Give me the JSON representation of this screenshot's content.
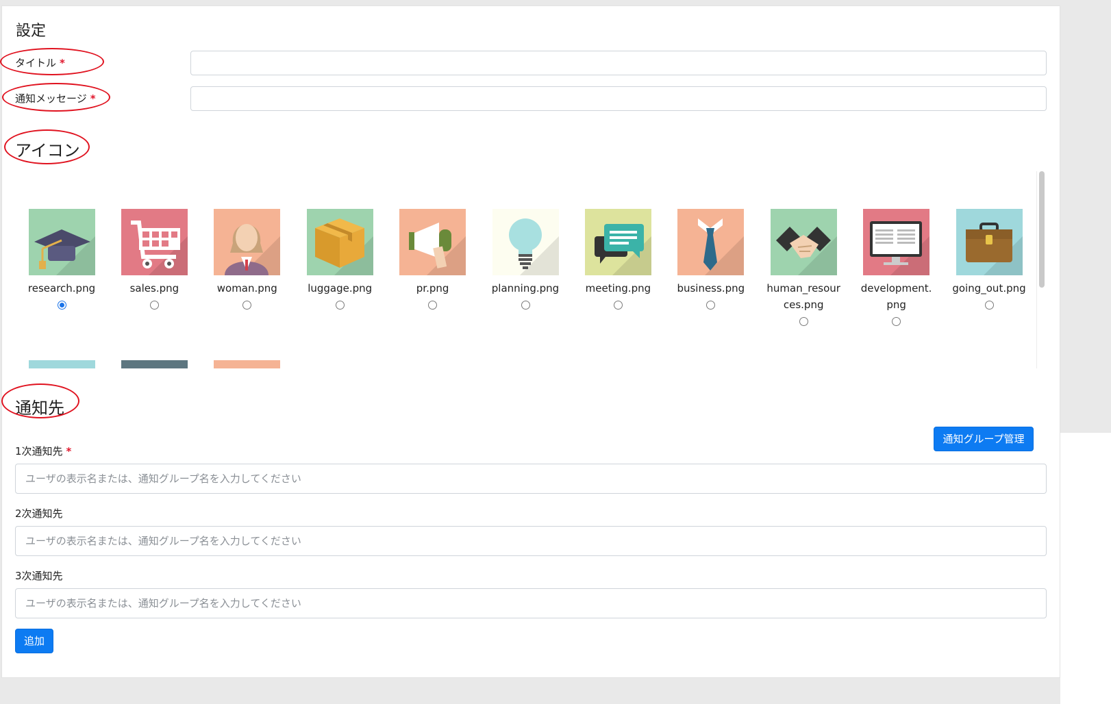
{
  "settings": {
    "title": "設定",
    "fields": [
      {
        "label": "タイトル",
        "required_mark": "*",
        "value": ""
      },
      {
        "label": "通知メッセージ",
        "required_mark": "*",
        "value": ""
      }
    ]
  },
  "icons": {
    "title": "アイコン",
    "items": [
      {
        "name": "research.png",
        "bg": "#9ed3ae",
        "symbol": "graduation-cap-icon",
        "selected": true
      },
      {
        "name": "sales.png",
        "bg": "#e27a85",
        "symbol": "shopping-cart-icon",
        "selected": false
      },
      {
        "name": "woman.png",
        "bg": "#f5b394",
        "symbol": "woman-icon",
        "selected": false
      },
      {
        "name": "luggage.png",
        "bg": "#9ed3ae",
        "symbol": "box-icon",
        "selected": false
      },
      {
        "name": "pr.png",
        "bg": "#f5b394",
        "symbol": "megaphone-icon",
        "selected": false
      },
      {
        "name": "planning.png",
        "bg": "#fdfdf0",
        "symbol": "lightbulb-icon",
        "selected": false
      },
      {
        "name": "meeting.png",
        "bg": "#dde39d",
        "symbol": "speech-bubbles-icon",
        "selected": false
      },
      {
        "name": "business.png",
        "bg": "#f5b394",
        "symbol": "necktie-icon",
        "selected": false
      },
      {
        "name": "human_resources.png",
        "bg": "#9ed3ae",
        "symbol": "handshake-icon",
        "selected": false
      },
      {
        "name": "development.png",
        "bg": "#e27a85",
        "symbol": "monitor-icon",
        "selected": false
      },
      {
        "name": "going_out.png",
        "bg": "#9fd8dc",
        "symbol": "briefcase-icon",
        "selected": false
      }
    ],
    "second_row_colors": [
      "#9fd8dc",
      "#5d7680",
      "#f5b394"
    ]
  },
  "recipients": {
    "title": "通知先",
    "manage_button": "通知グループ管理",
    "fields": [
      {
        "label": "1次通知先",
        "required_mark": "*",
        "placeholder": "ユーザの表示名または、通知グループ名を入力してください"
      },
      {
        "label": "2次通知先",
        "placeholder": "ユーザの表示名または、通知グループ名を入力してください"
      },
      {
        "label": "3次通知先",
        "placeholder": "ユーザの表示名または、通知グループ名を入力してください"
      }
    ],
    "add_button": "追加"
  },
  "annotation_color": "#e0121f",
  "accent_color": "#0d7bf2"
}
